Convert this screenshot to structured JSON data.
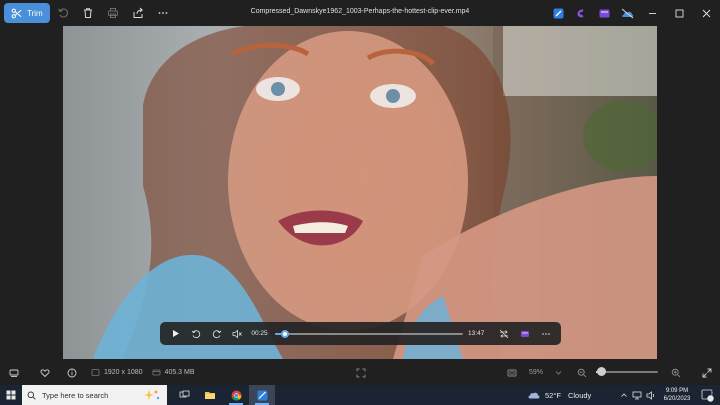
{
  "toolbar": {
    "trim_label": "Trim",
    "file_title": "Compressed_Dawnskye1962_1003-Perhaps-the-hottest-clip-ever.mp4",
    "icons": [
      "trim-icon",
      "rotate-icon",
      "delete-icon",
      "print-icon",
      "share-icon",
      "more-icon"
    ],
    "apps": [
      "designer-icon",
      "clipchamp-icon",
      "clipchamp-purple-icon",
      "onedrive-icon"
    ],
    "window": [
      "minimize-icon",
      "maximize-icon",
      "close-icon"
    ]
  },
  "player": {
    "current_time": "00:25",
    "duration": "13:47",
    "progress": 0.03,
    "icons": [
      "play-icon",
      "rewind-10-icon",
      "forward-30-icon",
      "volume-mute-icon",
      "repeat-off-icon",
      "clipchamp-icon",
      "more-icon"
    ]
  },
  "status": {
    "resolution": "1920 x 1080",
    "file_size": "405.3 MB",
    "zoom": "59%",
    "zoom_level": 0.08,
    "accent": "#63a8f0"
  },
  "taskbar": {
    "search_placeholder": "Type here to search",
    "weather_temp": "52°F",
    "weather_desc": "Cloudy",
    "time": "9:09 PM",
    "date": "6/20/2023",
    "notification_count": "2",
    "apps": [
      "task-view-icon",
      "file-explorer-icon",
      "chrome-icon",
      "photos-icon"
    ]
  }
}
